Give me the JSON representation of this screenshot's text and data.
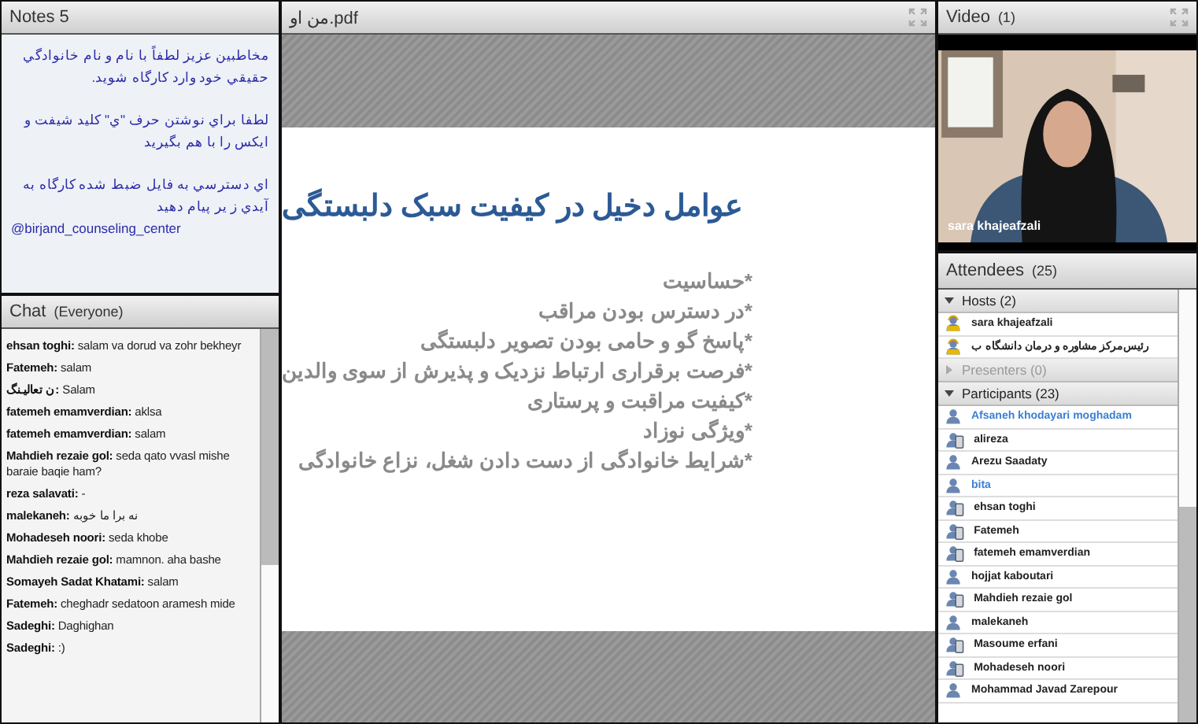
{
  "notes": {
    "title": "Notes 5",
    "paragraphs": [
      "مخاطبين عزيز لطفاً با نام و نام خانوادگي حقيقي خود وارد كارگاه شويد.",
      "لطفا براي نوشتن حرف \"ي\" كليد شيفت و ايكس را با هم بگيريد",
      "اي دسترسي به فايل ضبط شده كارگاه به آيدي ز ير پيام دهيد",
      "@birjand_counseling_center"
    ]
  },
  "chat": {
    "title": "Chat",
    "audience": "(Everyone)",
    "messages": [
      "**ehsan toghi:** salam va dorud va zohr bekheyr",
      "**Fatemeh:** salam",
      "**ن تعاليـنگ:** Salam",
      "**fatemeh emamverdian:** aklsa",
      "**fatemeh emamverdian:** salam",
      "**Mahdieh rezaie gol:** seda qato vvasl mishe baraie baqie ham?",
      "**reza salavati:** -",
      "**malekaneh:** نه برا ما خوبه",
      "**Mohadeseh noori:** seda khobe",
      "**Mahdieh rezaie gol:** mamnon. aha bashe",
      "**Somayeh Sadat Khatami:** salam",
      "**Fatemeh:** cheghadr sedatoon aramesh mide",
      "**Sadeghi:** Daghighan",
      "**Sadeghi:** :)"
    ]
  },
  "share": {
    "title": "من او.pdf",
    "slide": {
      "title": "عوامل دخیل در کیفیت سبک دلبستگی",
      "bullets": [
        "*حساسیت",
        "*در دسترس بودن مراقب",
        "*پاسخ گو و حامی بودن تصویر دلبستگی",
        "*فرصت برقراری ارتباط نزدیک و پذیرش از سوی والدین",
        "*کیفیت مراقبت و پرستاری",
        "*ویژگی نوزاد",
        "*شرایط خانوادگی از دست دادن شغل، نزاع خانوادگی"
      ]
    }
  },
  "video": {
    "title": "Video",
    "count": "(1)",
    "caption": "sara khajeafzali"
  },
  "attendees": {
    "title": "Attendees",
    "count": "(25)",
    "groups": [
      {
        "label": "Hosts (2)",
        "expanded": true,
        "people": [
          {
            "name": "sara khajeafzali",
            "kind": "host",
            "color": "#222222"
          },
          {
            "name": "رئيس‌مركز مشاوره و درمان دانشگاه ب",
            "kind": "host",
            "color": "#222222"
          }
        ]
      },
      {
        "label": "Presenters (0)",
        "expanded": false
      },
      {
        "label": "Participants (23)",
        "expanded": true,
        "people": [
          {
            "name": "Afsaneh khodayari moghadam",
            "kind": "person",
            "color": "#3b7fd4"
          },
          {
            "name": "alireza",
            "kind": "mobile",
            "color": "#222222"
          },
          {
            "name": "Arezu Saadaty",
            "kind": "person",
            "color": "#222222"
          },
          {
            "name": "bita",
            "kind": "person",
            "color": "#3b7fd4"
          },
          {
            "name": "ehsan toghi",
            "kind": "mobile",
            "color": "#222222"
          },
          {
            "name": "Fatemeh",
            "kind": "mobile",
            "color": "#222222"
          },
          {
            "name": "fatemeh emamverdian",
            "kind": "mobile",
            "color": "#222222"
          },
          {
            "name": "hojjat kaboutari",
            "kind": "person",
            "color": "#222222"
          },
          {
            "name": "Mahdieh rezaie gol",
            "kind": "mobile",
            "color": "#222222"
          },
          {
            "name": "malekaneh",
            "kind": "person",
            "color": "#222222"
          },
          {
            "name": "Masoume erfani",
            "kind": "mobile",
            "color": "#222222"
          },
          {
            "name": "Mohadeseh noori",
            "kind": "mobile",
            "color": "#222222"
          },
          {
            "name": "Mohammad Javad Zarepour",
            "kind": "person",
            "color": "#222222"
          }
        ]
      }
    ]
  }
}
